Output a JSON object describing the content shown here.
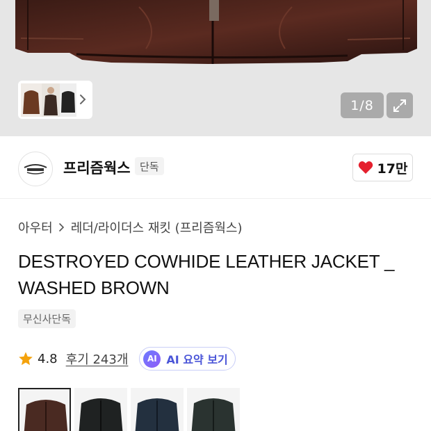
{
  "gallery": {
    "counter": "1/8",
    "icons": {
      "expand": "expand-arrows-icon",
      "next": "chevron-right-icon"
    }
  },
  "brand": {
    "name": "프리즘웍스",
    "badge": "단독",
    "likes": "17만",
    "icons": {
      "like": "heart-icon"
    }
  },
  "product": {
    "breadcrumb": [
      "아우터",
      "레더/라이더스 재킷 (프리즘웍스)"
    ],
    "title": "DESTROYED COWHIDE LEATHER JACKET _ WASHED BROWN",
    "tag": "무신사단독",
    "rating": "4.8",
    "reviews": "후기 243개",
    "ai_badge": "AI",
    "ai_label": "AI 요약 보기"
  },
  "colors": {
    "like_heart": "#e5202e",
    "star": "#f4a20c",
    "ai_accent": "#4a55d8"
  },
  "swatch_colors": [
    "#4a2a22",
    "#1f2222",
    "#23303f",
    "#2a3330"
  ]
}
